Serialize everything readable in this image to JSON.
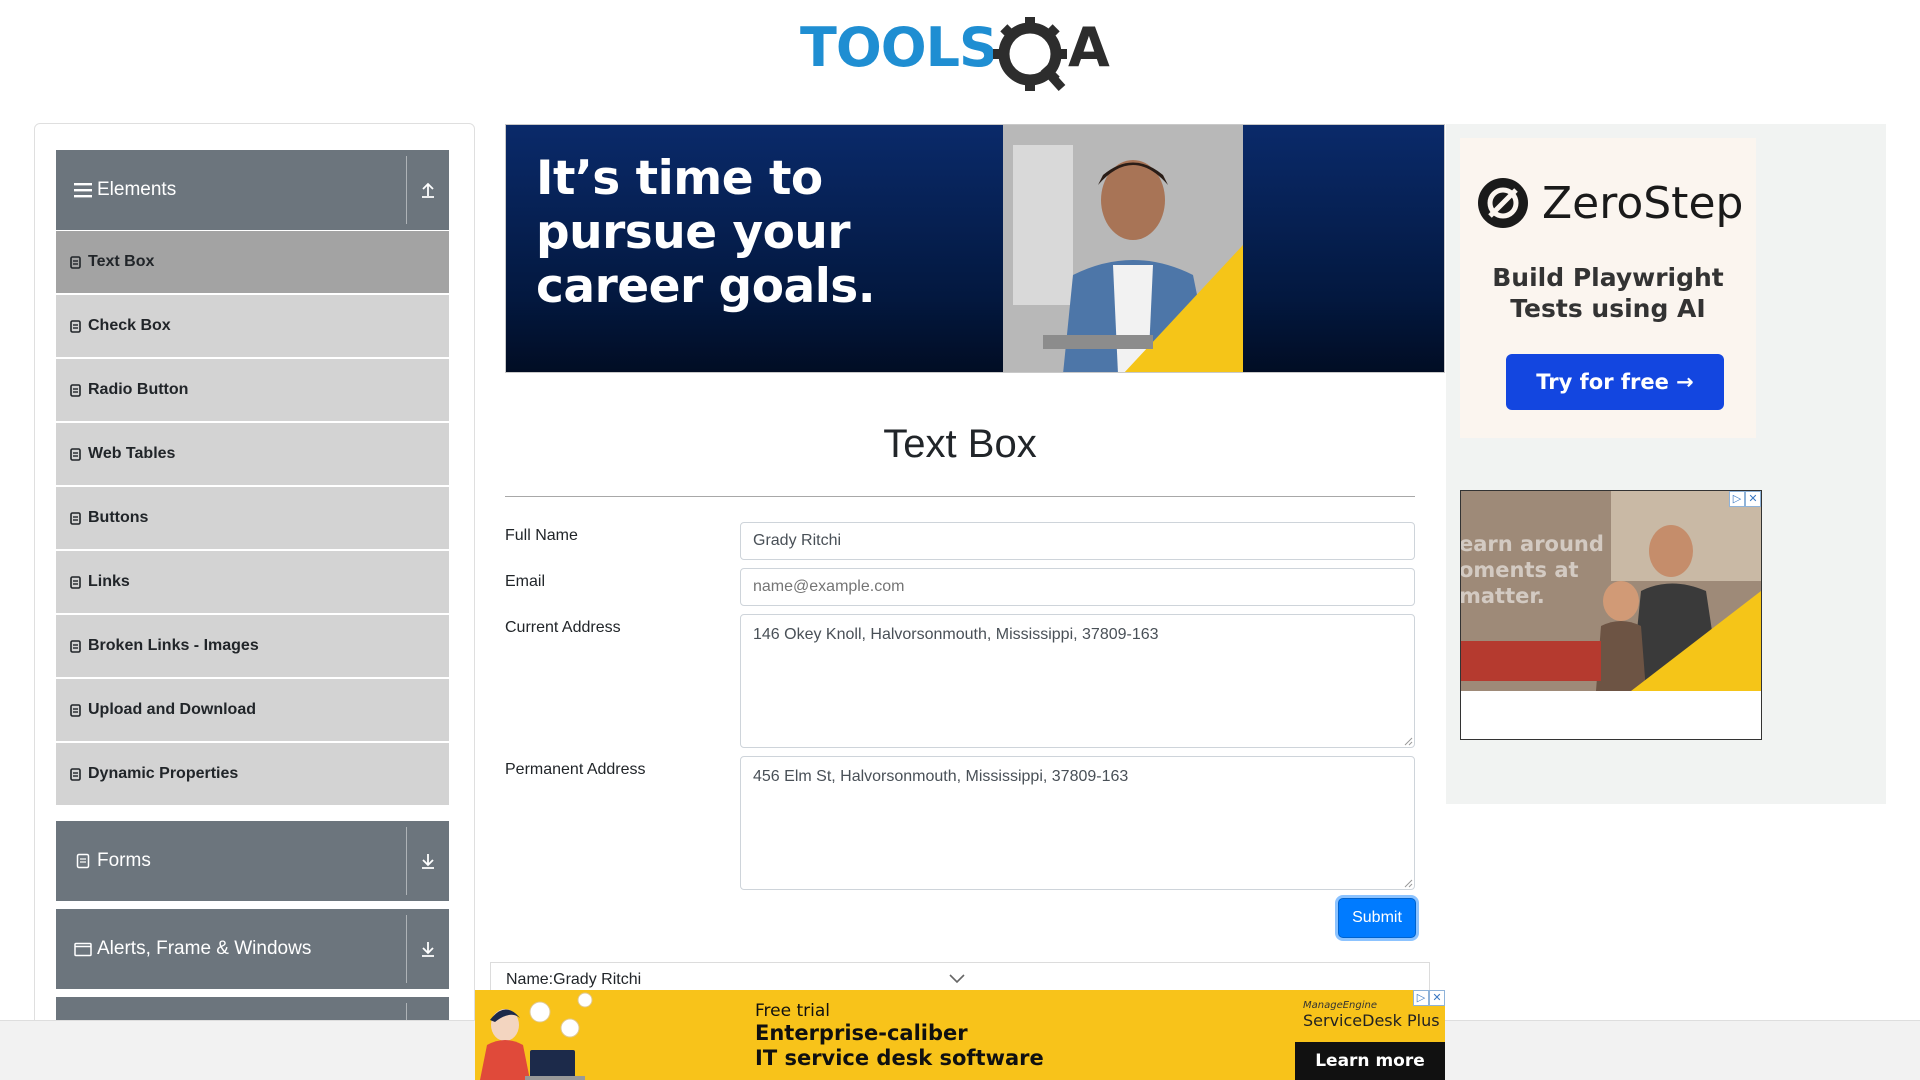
{
  "brand": {
    "logo_text": "TOOLSQA"
  },
  "sidebar": {
    "groups": [
      {
        "title": "Elements",
        "icon": "hamburger-icon",
        "toggle": "collapse-arrow-icon"
      },
      {
        "title": "Forms",
        "icon": "form-icon",
        "toggle": "expand-arrow-icon"
      },
      {
        "title": "Alerts, Frame & Windows",
        "icon": "window-icon",
        "toggle": "expand-arrow-icon"
      }
    ],
    "items": [
      {
        "label": "Text Box",
        "active": true
      },
      {
        "label": "Check Box"
      },
      {
        "label": "Radio Button"
      },
      {
        "label": "Web Tables"
      },
      {
        "label": "Buttons"
      },
      {
        "label": "Links"
      },
      {
        "label": "Broken Links - Images"
      },
      {
        "label": "Upload and Download"
      },
      {
        "label": "Dynamic Properties"
      }
    ]
  },
  "banner": {
    "headline": "It’s time to pursue your career goals."
  },
  "right_ad": {
    "brand": "ZeroStep",
    "subtitle": "Build Playwright Tests using AI",
    "cta": "Try for free →",
    "photo_overlay_text": "earn around oments at matter."
  },
  "main": {
    "title": "Text Box",
    "fields": {
      "full_name_label": "Full Name",
      "full_name_value": "Grady Ritchi",
      "email_label": "Email",
      "email_placeholder": "name@example.com",
      "current_address_label": "Current Address",
      "current_address_value": "146 Okey Knoll, Halvorsonmouth, Mississippi, 37809-163",
      "permanent_address_label": "Permanent Address",
      "permanent_address_value": "456 Elm St, Halvorsonmouth, Mississippi, 37809-163"
    },
    "submit_label": "Submit",
    "output": {
      "name_line": "Name:Grady Ritchi"
    }
  },
  "bottom_ad": {
    "small": "Free trial",
    "line1": "Enterprise-caliber",
    "line2": "IT service desk software",
    "brand_small": "ManageEngine",
    "brand": "ServiceDesk Plus",
    "cta": "Learn more"
  },
  "colors": {
    "sidebar_header": "#6c757d",
    "sidebar_item": "#d3d3d3",
    "sidebar_active": "#a3a3a3",
    "primary": "#007bff"
  }
}
